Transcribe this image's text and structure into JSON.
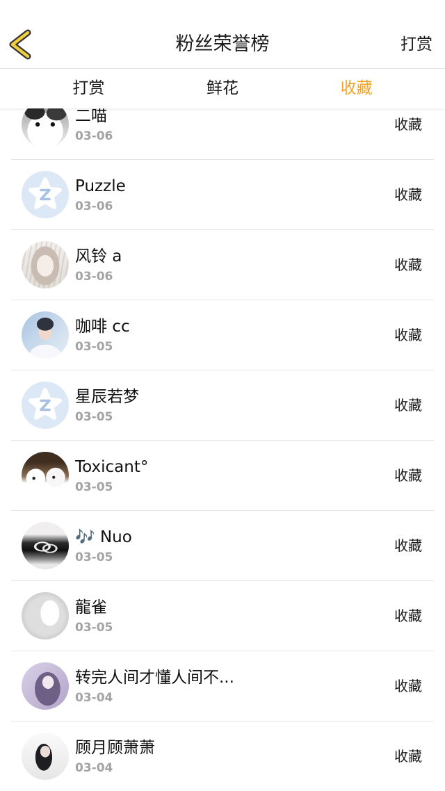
{
  "header": {
    "back_icon": "chevron-left-icon",
    "title": "粉丝荣誉榜",
    "right_action": "打赏"
  },
  "tabs": [
    {
      "label": "打赏",
      "active": false
    },
    {
      "label": "鲜花",
      "active": false
    },
    {
      "label": "收藏",
      "active": true
    }
  ],
  "colors": {
    "accent": "#F2A428",
    "text": "#1A1A1A",
    "secondary_text": "#A3A3A3",
    "divider": "#E6E6E6",
    "back_icon_fill": "#F0CF3A",
    "back_icon_outline": "#333333",
    "default_avatar_bg": "#DCE8F6"
  },
  "fans": [
    {
      "name": "二喵",
      "date": "03-06",
      "type": "收藏",
      "avatar": "cat-photo-avatar"
    },
    {
      "name": "Puzzle",
      "date": "03-06",
      "type": "收藏",
      "avatar": "default-star-avatar"
    },
    {
      "name": "风铃 a",
      "date": "03-06",
      "type": "收藏",
      "avatar": "sketch-girl-avatar"
    },
    {
      "name": "咖啡 cc",
      "date": "03-05",
      "type": "收藏",
      "avatar": "young-man-photo-avatar"
    },
    {
      "name": "星辰若梦",
      "date": "03-05",
      "type": "收藏",
      "avatar": "default-star-avatar"
    },
    {
      "name": "Toxicant°",
      "date": "03-05",
      "type": "收藏",
      "avatar": "white-dogs-photo-avatar"
    },
    {
      "name": "🎶 Nuo",
      "date": "03-05",
      "type": "收藏",
      "avatar": "heart-ring-photo-avatar"
    },
    {
      "name": "龍雀",
      "date": "03-05",
      "type": "收藏",
      "avatar": "white-figure-avatar"
    },
    {
      "name": "转完人间才懂人间不...",
      "date": "03-04",
      "type": "收藏",
      "avatar": "purple-figure-avatar"
    },
    {
      "name": "顾月顾萧萧",
      "date": "03-04",
      "type": "收藏",
      "avatar": "dark-hair-figure-avatar"
    }
  ]
}
